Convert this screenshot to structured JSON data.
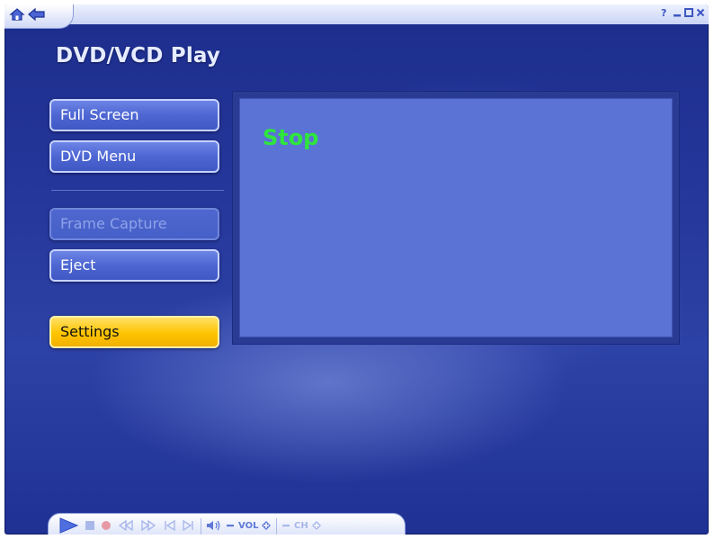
{
  "app": {
    "title": "DVD/VCD Play"
  },
  "titlebar": {
    "home_icon": "home-icon",
    "back_icon": "back-arrow-icon",
    "controls": [
      "help-icon",
      "minimize-icon",
      "maximize-icon",
      "close-icon"
    ]
  },
  "menu": {
    "full_screen": "Full Screen",
    "dvd_menu": "DVD Menu",
    "frame_capture": "Frame Capture",
    "eject": "Eject",
    "settings": "Settings"
  },
  "video": {
    "status": "Stop"
  },
  "transport": {
    "vol_label": "VOL",
    "ch_label": "CH",
    "icons": [
      "play-icon",
      "stop-icon",
      "record-icon",
      "rewind-icon",
      "fast-forward-icon",
      "previous-icon",
      "next-icon",
      "mute-icon",
      "volume-down-icon",
      "volume-up-icon",
      "channel-down-icon",
      "channel-up-icon"
    ]
  },
  "colors": {
    "background": "#26389c",
    "button": "#4d66d2",
    "button_highlight": "#ffc400",
    "video_area": "#5b73d4",
    "status_text": "#2ee63c"
  }
}
